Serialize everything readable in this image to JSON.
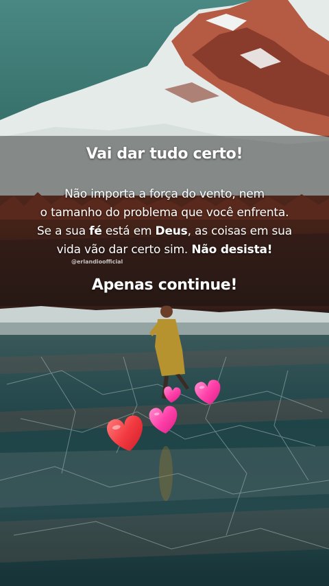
{
  "quote": {
    "title": "Vai dar tudo certo!",
    "line1": "Não importa a força do vento, nem",
    "line2": "o tamanho do problema que você enfrenta.",
    "line3_a": "Se a sua ",
    "line3_b": "fé",
    "line3_c": " está em ",
    "line3_d": "Deus",
    "line3_e": ", as coisas em sua",
    "line4_a": "vida vão dar certo sim. ",
    "line4_b": "Não desista!",
    "closing": "Apenas continue!"
  },
  "watermark": "@erlandioofficial",
  "colors": {
    "sky": "#3f7a75",
    "snow": "#e6ecea",
    "rock": "#b9573f",
    "forest": "#5b2418",
    "ice": "#22484d",
    "coat": "#b7932f",
    "heart_red": "#f2393f",
    "heart_pink": "#ff3fa8"
  },
  "icons": [
    "heart-icon-large-red",
    "heart-icon-pink"
  ]
}
